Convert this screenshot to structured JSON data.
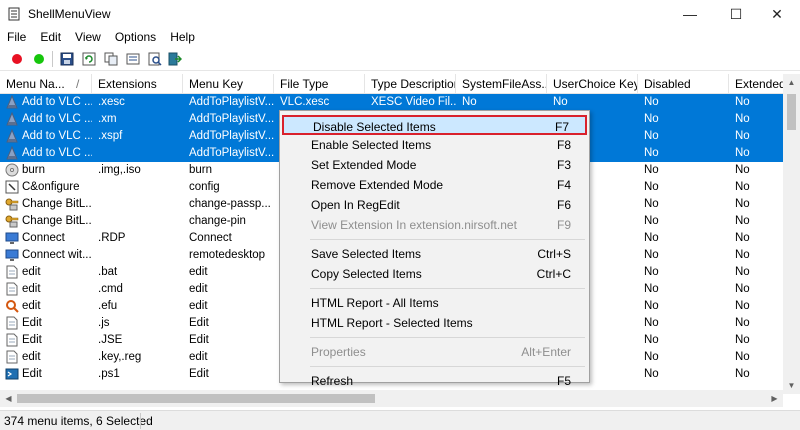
{
  "window": {
    "title": "ShellMenuView",
    "min_glyph": "—",
    "max_glyph": "☐",
    "close_glyph": "✕"
  },
  "menubar": [
    "File",
    "Edit",
    "View",
    "Options",
    "Help"
  ],
  "toolbar": {
    "icons": [
      "red-dot-icon",
      "green-dot-icon",
      "save-icon",
      "refresh-icon",
      "copy-icon",
      "properties-icon",
      "find-icon",
      "exit-icon"
    ]
  },
  "columns": [
    "Menu Na...",
    "Extensions",
    "Menu Key",
    "File Type",
    "Type Description",
    "SystemFileAss...",
    "UserChoice Key",
    "Disabled",
    "Extended"
  ],
  "sort_indicator": "/",
  "rows": [
    {
      "name": "Add to VLC ...",
      "ext": ".xesc",
      "key": "AddToPlaylistV...",
      "ftype": "VLC.xesc",
      "tdesc": "XESC Video Fil...",
      "sfa": "No",
      "uck": "No",
      "disabled": "No",
      "extended": "No",
      "selected": true,
      "icon": "vlc-icon"
    },
    {
      "name": "Add to VLC ...",
      "ext": ".xm",
      "key": "AddToPlaylistV...",
      "ftype": "",
      "tdesc": "",
      "sfa": "",
      "uck": "",
      "disabled": "No",
      "extended": "No",
      "selected": true,
      "icon": "vlc-icon"
    },
    {
      "name": "Add to VLC ...",
      "ext": ".xspf",
      "key": "AddToPlaylistV...",
      "ftype": "",
      "tdesc": "",
      "sfa": "",
      "uck": "",
      "disabled": "No",
      "extended": "No",
      "selected": true,
      "icon": "vlc-icon"
    },
    {
      "name": "Add to VLC ...",
      "ext": "",
      "key": "AddToPlaylistV...",
      "ftype": "",
      "tdesc": "",
      "sfa": "",
      "uck": "",
      "disabled": "No",
      "extended": "No",
      "selected": true,
      "icon": "vlc-icon"
    },
    {
      "name": "burn",
      "ext": ".img,.iso",
      "key": "burn",
      "ftype": "",
      "tdesc": "",
      "sfa": "",
      "uck": "",
      "disabled": "No",
      "extended": "No",
      "selected": false,
      "icon": "burn-icon"
    },
    {
      "name": "C&onfigure",
      "ext": "",
      "key": "config",
      "ftype": "",
      "tdesc": "",
      "sfa": "",
      "uck": "",
      "disabled": "No",
      "extended": "No",
      "selected": false,
      "icon": "configure-icon"
    },
    {
      "name": "Change BitL...",
      "ext": "",
      "key": "change-passp...",
      "ftype": "",
      "tdesc": "",
      "sfa": "",
      "uck": "",
      "disabled": "No",
      "extended": "No",
      "selected": false,
      "icon": "key-icon"
    },
    {
      "name": "Change BitL...",
      "ext": "",
      "key": "change-pin",
      "ftype": "",
      "tdesc": "",
      "sfa": "",
      "uck": "",
      "disabled": "No",
      "extended": "No",
      "selected": false,
      "icon": "key-icon"
    },
    {
      "name": "Connect",
      "ext": ".RDP",
      "key": "Connect",
      "ftype": "",
      "tdesc": "",
      "sfa": "",
      "uck": "",
      "disabled": "No",
      "extended": "No",
      "selected": false,
      "icon": "remote-desktop-icon"
    },
    {
      "name": "Connect wit...",
      "ext": "",
      "key": "remotedesktop",
      "ftype": "",
      "tdesc": "",
      "sfa": "",
      "uck": "",
      "disabled": "No",
      "extended": "No",
      "selected": false,
      "icon": "remote-desktop-icon"
    },
    {
      "name": "edit",
      "ext": ".bat",
      "key": "edit",
      "ftype": "",
      "tdesc": "",
      "sfa": "",
      "uck": "",
      "disabled": "No",
      "extended": "No",
      "selected": false,
      "icon": "file-icon"
    },
    {
      "name": "edit",
      "ext": ".cmd",
      "key": "edit",
      "ftype": "",
      "tdesc": "",
      "sfa": "",
      "uck": "",
      "disabled": "No",
      "extended": "No",
      "selected": false,
      "icon": "file-icon"
    },
    {
      "name": "edit",
      "ext": ".efu",
      "key": "edit",
      "ftype": "",
      "tdesc": "",
      "sfa": "",
      "uck": "",
      "disabled": "No",
      "extended": "No",
      "selected": false,
      "icon": "search-file-icon"
    },
    {
      "name": "Edit",
      "ext": ".js",
      "key": "Edit",
      "ftype": "",
      "tdesc": "",
      "sfa": "",
      "uck": "",
      "disabled": "No",
      "extended": "No",
      "selected": false,
      "icon": "file-icon"
    },
    {
      "name": "Edit",
      "ext": ".JSE",
      "key": "Edit",
      "ftype": "",
      "tdesc": "",
      "sfa": "",
      "uck": "",
      "disabled": "No",
      "extended": "No",
      "selected": false,
      "icon": "file-icon"
    },
    {
      "name": "edit",
      "ext": ".key,.reg",
      "key": "edit",
      "ftype": "",
      "tdesc": "",
      "sfa": "",
      "uck": "",
      "disabled": "No",
      "extended": "No",
      "selected": false,
      "icon": "file-icon"
    },
    {
      "name": "Edit",
      "ext": ".ps1",
      "key": "Edit",
      "ftype": "",
      "tdesc": "",
      "sfa": "",
      "uck": "",
      "disabled": "No",
      "extended": "No",
      "selected": false,
      "icon": "powershell-icon"
    }
  ],
  "context_menu": [
    {
      "label": "Disable Selected Items",
      "key": "F7",
      "highlighted": true
    },
    {
      "label": "Enable Selected Items",
      "key": "F8"
    },
    {
      "label": "Set Extended Mode",
      "key": "F3"
    },
    {
      "label": "Remove Extended Mode",
      "key": "F4"
    },
    {
      "label": "Open In RegEdit",
      "key": "F6"
    },
    {
      "label": "View Extension In extension.nirsoft.net",
      "key": "F9",
      "disabled": true
    },
    {
      "separator": true
    },
    {
      "label": "Save Selected Items",
      "key": "Ctrl+S"
    },
    {
      "label": "Copy Selected Items",
      "key": "Ctrl+C"
    },
    {
      "separator": true
    },
    {
      "label": "HTML Report - All Items",
      "key": ""
    },
    {
      "label": "HTML Report - Selected Items",
      "key": ""
    },
    {
      "separator": true
    },
    {
      "label": "Properties",
      "key": "Alt+Enter",
      "disabled": true
    },
    {
      "separator": true
    },
    {
      "label": "Refresh",
      "key": "F5"
    }
  ],
  "status": {
    "text": "374 menu items, 6 Selected"
  },
  "colors": {
    "selection": "#0078d7",
    "menu_highlight": "#cce8ff",
    "menu_highlight_border": "#d9212c"
  }
}
